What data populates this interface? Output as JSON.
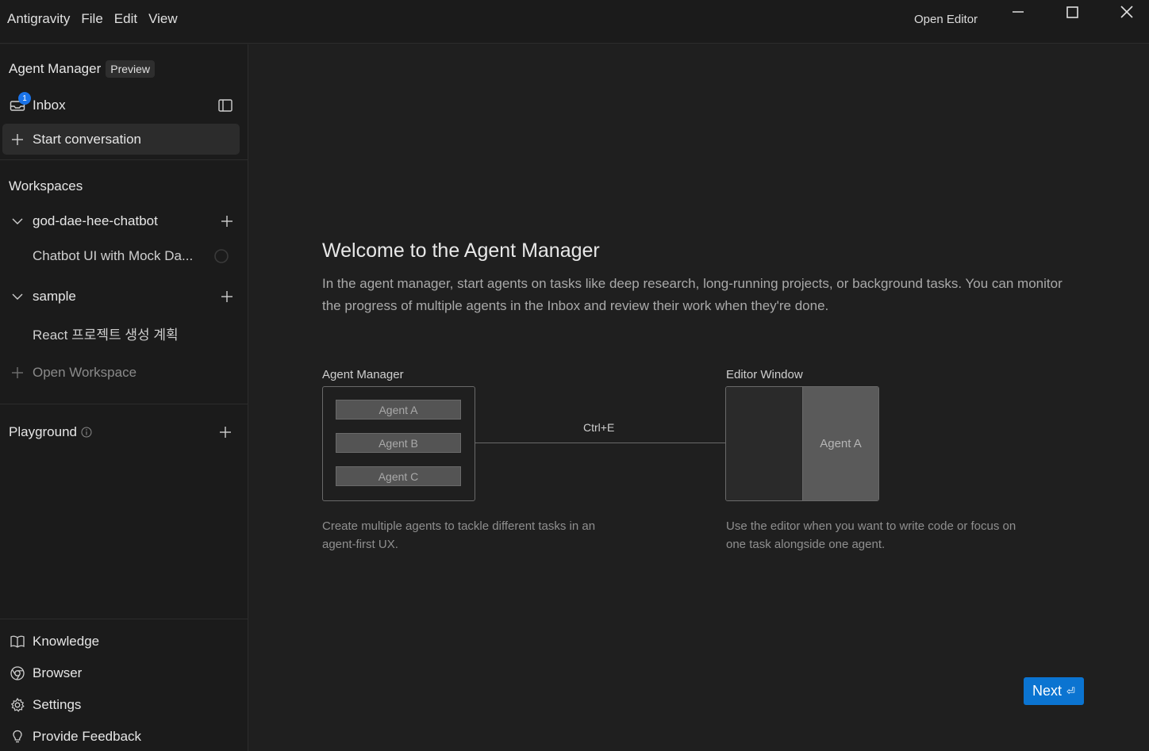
{
  "titlebar": {
    "menu": [
      "Antigravity",
      "File",
      "Edit",
      "View"
    ],
    "open_editor": "Open Editor"
  },
  "sidebar": {
    "header": "Agent Manager",
    "preview_badge": "Preview",
    "inbox": "Inbox",
    "inbox_count": "1",
    "start_conversation": "Start conversation",
    "workspaces_title": "Workspaces",
    "workspaces": [
      {
        "name": "god-dae-hee-chatbot",
        "items": [
          "Chatbot UI with Mock Da..."
        ]
      },
      {
        "name": "sample",
        "items": [
          "React 프로젝트 생성 계획"
        ]
      }
    ],
    "open_workspace": "Open Workspace",
    "playground": "Playground",
    "bottom": [
      "Knowledge",
      "Browser",
      "Settings",
      "Provide Feedback"
    ]
  },
  "main": {
    "title": "Welcome to the Agent Manager",
    "description": "In the agent manager, start agents on tasks like deep research, long-running projects, or background tasks. You can monitor the progress of multiple agents in the Inbox and review their work when they're done.",
    "diagram": {
      "left_label": "Agent Manager",
      "agents": [
        "Agent A",
        "Agent B",
        "Agent C"
      ],
      "shortcut": "Ctrl+E",
      "right_label": "Editor Window",
      "editor_agent": "Agent A",
      "left_caption": "Create multiple agents to tackle different tasks in an agent-first UX.",
      "right_caption": "Use the editor when you want to write code or focus on one task alongside one agent."
    },
    "next_button": "Next",
    "next_hint": "⏎"
  },
  "colors": {
    "accent": "#0b74d1",
    "notification": "#1a73e8",
    "background": "#1f1f1f",
    "sidebar": "#1b1b1b"
  }
}
